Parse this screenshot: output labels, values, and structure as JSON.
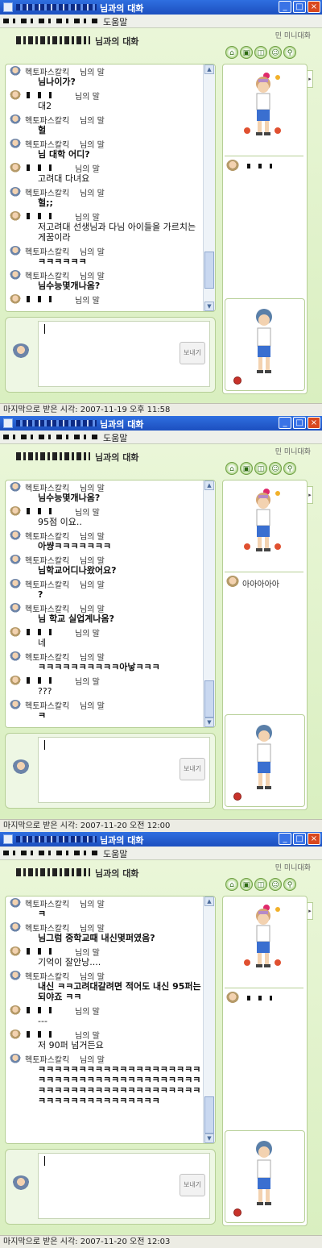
{
  "window_title_suffix": "님과의 대화",
  "menu_help": "도움말",
  "header_suffix": "님과의 대화",
  "mini_homepage": "민 미니대화",
  "name_suffix": "님의 말",
  "send_label": "보내기",
  "input_caret": "|",
  "windows": [
    {
      "status": "마지막으로 받은 시각: 2007-11-19 오후 11:58",
      "side_name": "",
      "messages": [
        {
          "sender": "me",
          "name": "헥토파스칼킥",
          "text": "님나이가?",
          "bold": true
        },
        {
          "sender": "you",
          "name": "",
          "text": "대2",
          "bold": false
        },
        {
          "sender": "me",
          "name": "헥토파스칼킥",
          "text": "헐",
          "bold": true
        },
        {
          "sender": "me",
          "name": "헥토파스칼킥",
          "text": "님 대학 어디?",
          "bold": true
        },
        {
          "sender": "you",
          "name": "",
          "text": "고려대 다녀요",
          "bold": false
        },
        {
          "sender": "me",
          "name": "헥토파스칼킥",
          "text": "헐;;",
          "bold": true
        },
        {
          "sender": "you",
          "name": "",
          "text": "저고려대 선생님과 다님 아이들을 가르치는게꿈이라",
          "bold": false
        },
        {
          "sender": "me",
          "name": "헥토파스칼킥",
          "text": "ㅋㅋㅋㅋㅋㅋ",
          "bold": true
        },
        {
          "sender": "me",
          "name": "헥토파스칼킥",
          "text": "님수능몇개나옴?",
          "bold": true
        },
        {
          "sender": "you",
          "name": "",
          "text": "",
          "bold": false
        }
      ]
    },
    {
      "status": "마지막으로 받은 시각: 2007-11-20 오전 12:00",
      "side_name": "아아아아아",
      "messages": [
        {
          "sender": "me",
          "name": "헥토파스칼킥",
          "text": "님수능몇개나옴?",
          "bold": true
        },
        {
          "sender": "you",
          "name": "",
          "text": "95점 이요..",
          "bold": false
        },
        {
          "sender": "me",
          "name": "헥토파스칼킥",
          "text": "아썅ㅋㅋㅋㅋㅋㅋㅋ",
          "bold": true
        },
        {
          "sender": "me",
          "name": "헥토파스칼킥",
          "text": "님학교어디나왔어요?",
          "bold": true
        },
        {
          "sender": "me",
          "name": "헥토파스칼킥",
          "text": "?",
          "bold": true
        },
        {
          "sender": "me",
          "name": "헥토파스칼킥",
          "text": "님 학교 실업계나옴?",
          "bold": true
        },
        {
          "sender": "you",
          "name": "",
          "text": "네",
          "bold": false
        },
        {
          "sender": "me",
          "name": "헥토파스칼킥",
          "text": "ㅋㅋㅋㅋㅋㅋㅋㅋㅋㅋ아낳ㅋㅋㅋ",
          "bold": true
        },
        {
          "sender": "you",
          "name": "",
          "text": "???",
          "bold": false
        },
        {
          "sender": "me",
          "name": "헥토파스칼킥",
          "text": "ㅋ",
          "bold": true
        }
      ]
    },
    {
      "status": "마지막으로 받은 시각: 2007-11-20 오전 12:03",
      "side_name": "",
      "messages": [
        {
          "sender": "me",
          "name": "헥토파스칼킥",
          "text": "ㅋ",
          "bold": true
        },
        {
          "sender": "me",
          "name": "헥토파스칼킥",
          "text": "님그럼 중학교때 내신몇퍼였음?",
          "bold": true
        },
        {
          "sender": "you",
          "name": "",
          "text": "기억이 잘안낭....",
          "bold": false
        },
        {
          "sender": "me",
          "name": "헥토파스칼킥",
          "text": "내신 ㅋㅋ고려대갈려면 적어도 내신 95퍼는되야죠 ㅋㅋ",
          "bold": true
        },
        {
          "sender": "you",
          "name": "",
          "text": "---",
          "bold": false
        },
        {
          "sender": "you",
          "name": "",
          "text": "저 90퍼 넘거든요",
          "bold": false
        },
        {
          "sender": "me",
          "name": "헥토파스칼킥",
          "text": "ㅋㅋㅋㅋㅋㅋㅋㅋㅋㅋㅋㅋㅋㅋㅋㅋㅋㅋㅋㅋㅋㅋㅋㅋㅋㅋㅋㅋㅋㅋㅋㅋㅋㅋㅋㅋㅋㅋㅋㅋㅋㅋㅋㅋㅋㅋㅋㅋㅋㅋㅋㅋㅋㅋㅋㅋㅋㅋㅋㅋㅋㅋㅋㅋㅋㅋㅋㅋㅋㅋㅋㅋㅋㅋㅋ",
          "bold": true
        }
      ]
    }
  ]
}
